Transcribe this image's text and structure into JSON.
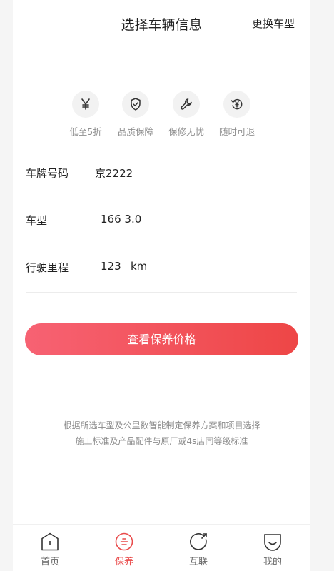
{
  "header": {
    "title": "选择车辆信息",
    "change_label": "更换车型"
  },
  "features": [
    {
      "label": "低至5折",
      "icon": "yen-icon"
    },
    {
      "label": "品质保障",
      "icon": "shield-check-icon"
    },
    {
      "label": "保修无忧",
      "icon": "wrench-icon"
    },
    {
      "label": "随时可退",
      "icon": "refund-icon"
    }
  ],
  "vehicle": {
    "plate_label": "车牌号码",
    "plate_value": "京2222",
    "model_label": "车型",
    "model_value": "166 3.0",
    "mileage_label": "行驶里程",
    "mileage_value": "123",
    "mileage_unit": "km"
  },
  "cta_label": "查看保养价格",
  "notes": [
    "根据所选车型及公里数智能制定保养方案和项目选择",
    "施工标准及产品配件与原厂或4s店同等级标准"
  ],
  "tabbar": [
    {
      "label": "首页",
      "icon": "home-icon",
      "active": false
    },
    {
      "label": "保养",
      "icon": "maintenance-icon",
      "active": true
    },
    {
      "label": "互联",
      "icon": "connect-icon",
      "active": false
    },
    {
      "label": "我的",
      "icon": "profile-icon",
      "active": false
    }
  ],
  "colors": {
    "accent": "#e94a4a",
    "cta_start": "#f76273",
    "cta_end": "#ee4646",
    "muted": "#8f8f8f"
  }
}
